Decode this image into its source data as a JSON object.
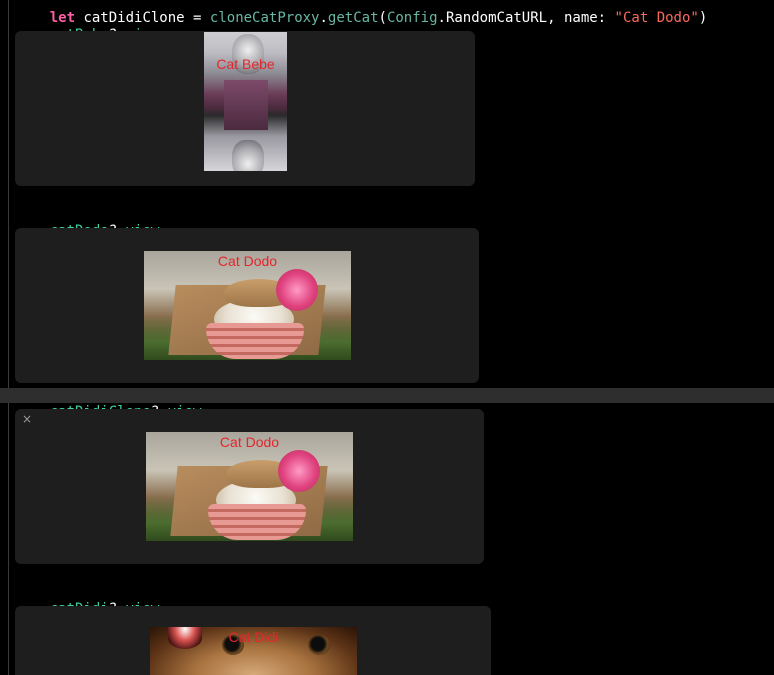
{
  "code": {
    "line0": {
      "keyword": "let",
      "var": "catDidiClone",
      "eq": " = ",
      "proxy": "cloneCatProxy",
      "dot1": ".",
      "method": "getCat",
      "paren": "(",
      "config": "Config",
      "dot2": ".",
      "url": "RandomCatURL",
      "name_arg": ", name: ",
      "str": "\"Cat Dodo\"",
      "close": ")"
    },
    "entries": [
      {
        "var": "catBebe",
        "op": "?.",
        "prop": "view"
      },
      {
        "var": "catDodo",
        "op": "?.",
        "prop": "view"
      },
      {
        "var": "catDidiClone",
        "op": "?.",
        "prop": "view"
      },
      {
        "var": "catDidi",
        "op": "?.",
        "prop": "view"
      }
    ]
  },
  "results": [
    {
      "caption": "Cat Bebe"
    },
    {
      "caption": "Cat Dodo"
    },
    {
      "caption": "Cat Dodo",
      "close_glyph": "×"
    },
    {
      "caption": "Cat Didi"
    }
  ],
  "colors": {
    "background": "#000000",
    "panel": "#1e1e1e",
    "keyword": "#fc5fa3",
    "identifier": "#41d2a2",
    "string": "#fc6a5d",
    "caption": "#e5262b",
    "current_line": "#2e2e2e"
  },
  "icons": {
    "close": "close-icon"
  }
}
